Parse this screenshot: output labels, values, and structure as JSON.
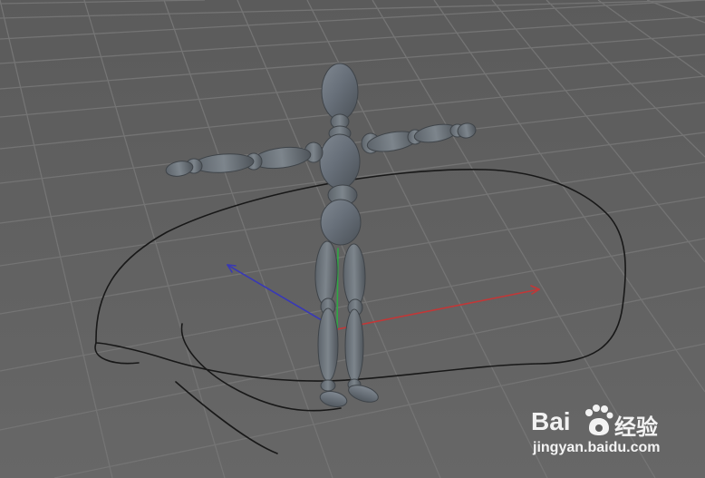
{
  "viewport": {
    "name": "3D viewport",
    "background_color": "#5f5f5f",
    "grid_color": "#767676",
    "axis_x_color": "#c93a3a",
    "axis_y_color": "#34b34a",
    "axis_z_color": "#4646c8",
    "spline_color": "#181818",
    "mannequin_color": "#6a7177"
  },
  "watermark": {
    "left_text": "Bai",
    "right_text": "经验",
    "url": "jingyan.baidu.com",
    "icon": "paw-icon"
  }
}
